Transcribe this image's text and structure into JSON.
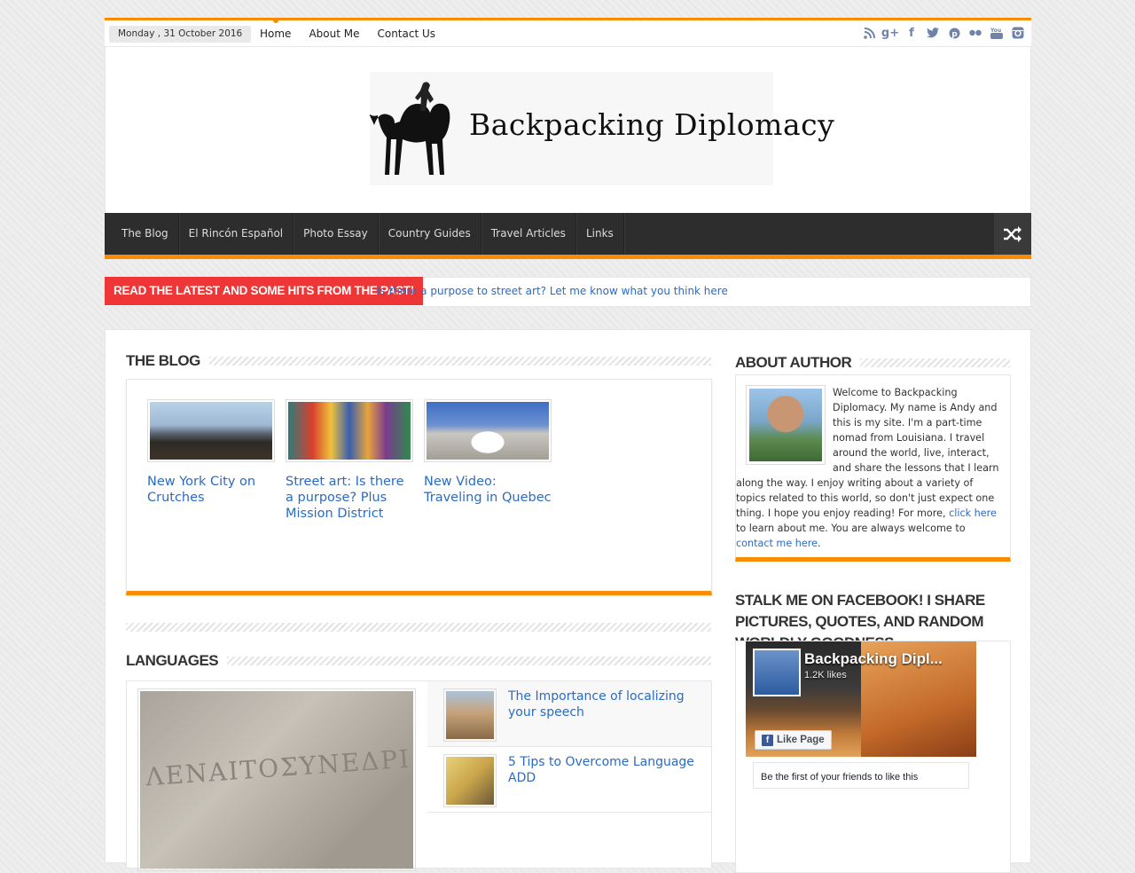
{
  "topbar": {
    "date": "Monday , 31 October 2016",
    "nav": [
      "Home",
      "About Me",
      "Contact Us"
    ],
    "social_icons": [
      "rss-icon",
      "google-plus-icon",
      "facebook-icon",
      "twitter-icon",
      "pinterest-icon",
      "flickr-icon",
      "youtube-icon",
      "instagram-icon"
    ]
  },
  "header": {
    "logo_text": "Backpacking Diplomacy"
  },
  "mainnav": [
    "The Blog",
    "El Rincón Español",
    "Photo Essay",
    "Country Guides",
    "Travel Articles",
    "Links"
  ],
  "ticker": {
    "label": "Read the latest and some hits from the past!",
    "text": "Is there a purpose to street art? Let me know what you think here"
  },
  "blog": {
    "heading": "The Blog",
    "posts": [
      {
        "title": "New York City on Crutches"
      },
      {
        "title": "Street art: Is there a purpose? Plus Mission District"
      },
      {
        "title": "New Video: Traveling in Quebec"
      }
    ]
  },
  "languages": {
    "heading": "Languages",
    "featured_inscription": "ΛΕΝΑΙΤΟΣΥΝΕΔΡΙ",
    "items": [
      {
        "title": "The Importance of localizing your speech"
      },
      {
        "title": "5 Tips to Overcome Language ADD"
      }
    ]
  },
  "about": {
    "heading": "About Author",
    "text_before_link1": "Welcome to Backpacking Diplomacy. My name is Andy and this is my site. I'm a part-time nomad from Louisiana. I travel around the world, live, interact, and share the lessons that I learn along the way. I enjoy writing about a variety of topics related to this world, so don't just expect one thing. I hope you enjoy reading! For more, ",
    "link1": "click here",
    "text_between": " to learn about me. You are always welcome to ",
    "link2": "contact me here",
    "text_after": "."
  },
  "facebook": {
    "heading": "Stalk me on facebook! I share pictures, quotes, and random worldly goodness.",
    "page_name": "Backpacking Dipl...",
    "likes": "1.2K likes",
    "like_button": "Like Page",
    "friends_text": "Be the first of your friends to like this"
  },
  "colors": {
    "accent": "#f88c00",
    "ticker_red": "#ef3636",
    "link": "#2b6bc4",
    "nav_bg": "#2d2d2d"
  }
}
